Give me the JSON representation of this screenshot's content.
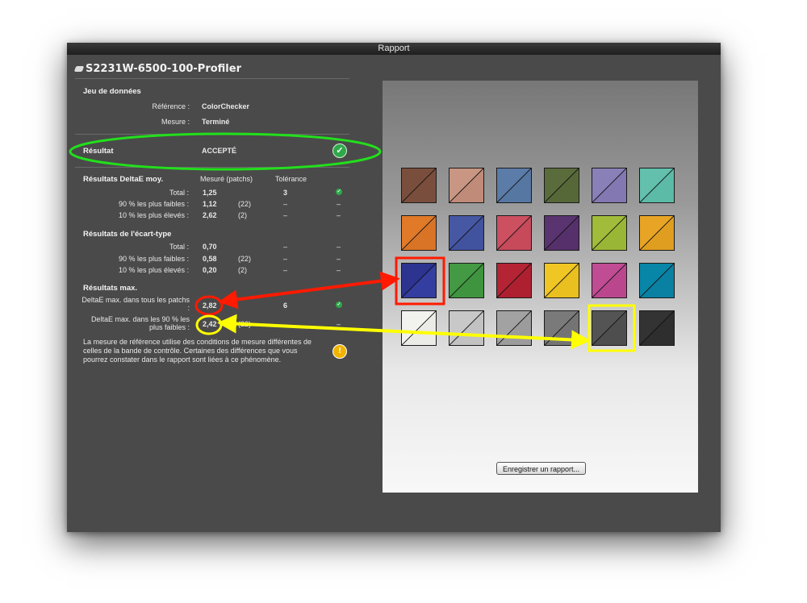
{
  "window": {
    "title": "Rapport"
  },
  "profile": {
    "title": "S2231W-6500-100-Profiler"
  },
  "dataset": {
    "header": "Jeu de données",
    "reference_label": "Référence :",
    "reference_value": "ColorChecker",
    "measure_label": "Mesure :",
    "measure_value": "Terminé"
  },
  "result": {
    "label": "Résultat",
    "value": "ACCEPTÉ"
  },
  "deltae_avg": {
    "header": "Résultats DeltaE moy.",
    "col_measured": "Mesuré (patchs)",
    "col_tolerance": "Tolérance",
    "rows": [
      {
        "label": "Total :",
        "value": "1,25",
        "patches": "",
        "tolerance": "3"
      },
      {
        "label": "90 % les plus faibles :",
        "value": "1,12",
        "patches": "(22)",
        "tolerance": "–"
      },
      {
        "label": "10 % les plus élevés :",
        "value": "2,62",
        "patches": "(2)",
        "tolerance": "–"
      }
    ],
    "row_status": [
      "–",
      "–"
    ]
  },
  "stddev": {
    "header": "Résultats de l'écart-type",
    "rows": [
      {
        "label": "Total :",
        "value": "0,70",
        "patches": "",
        "tolerance": "–",
        "status": "–"
      },
      {
        "label": "90 % les plus faibles :",
        "value": "0,58",
        "patches": "(22)",
        "tolerance": "–",
        "status": "–"
      },
      {
        "label": "10 % les plus élevés :",
        "value": "0,20",
        "patches": "(2)",
        "tolerance": "–",
        "status": "–"
      }
    ]
  },
  "max": {
    "header": "Résultats max.",
    "row1_label_line1": "DeltaE max. dans tous les patchs",
    "row1_label_line2": ":",
    "row1_value": "2,82",
    "row1_tolerance": "6",
    "row2_label_line1": "DeltaE max. dans les 90 % les",
    "row2_label_line2": "plus faibles :",
    "row2_value": "2,42",
    "row2_patches": "(22)",
    "row2_tolerance": "–",
    "row2_status": "–"
  },
  "note": {
    "line1": "La mesure de référence utilise des conditions de mesure différentes de",
    "line2": "celles de la bande de contrôle. Certaines des différences que vous",
    "line3": "pourrez constater dans le rapport sont liées à ce phénomène."
  },
  "icons": {
    "check": "check-icon",
    "warning": "warning-icon",
    "profile": "profile-icon"
  },
  "colors": {
    "highlight_green": "#22e01c",
    "highlight_red": "#ff1a00",
    "highlight_yellow": "#ffff00",
    "accept_green": "#2fa84a"
  },
  "patches": [
    [
      "#7a4e3c",
      "#7a4e3c"
    ],
    [
      "#c89682",
      "#c08b78"
    ],
    [
      "#5b7ca8",
      "#5677a2"
    ],
    [
      "#5a6b3c",
      "#576838"
    ],
    [
      "#8a80b8",
      "#8478b2"
    ],
    [
      "#62c0ac",
      "#5cbba6"
    ],
    [
      "#e07a28",
      "#d97426"
    ],
    [
      "#4658a4",
      "#41529e"
    ],
    [
      "#cc5060",
      "#c64a5a"
    ],
    [
      "#5a3470",
      "#55306a"
    ],
    [
      "#a0bc3a",
      "#9ab636"
    ],
    [
      "#e8a424",
      "#e09e20"
    ],
    [
      "#2c3490",
      "#343ea0"
    ],
    [
      "#449a44",
      "#3f943f"
    ],
    [
      "#b42434",
      "#ae2030"
    ],
    [
      "#f0c624",
      "#eabf20"
    ],
    [
      "#c04c94",
      "#ba478e"
    ],
    [
      "#0886a8",
      "#0a80a2"
    ],
    [
      "#f2f2ee",
      "#ebebe7"
    ],
    [
      "#c8c8c8",
      "#c2c2c2"
    ],
    [
      "#a2a2a2",
      "#9c9c9c"
    ],
    [
      "#7a7a7a",
      "#747474"
    ],
    [
      "#545454",
      "#4e4e4e"
    ],
    [
      "#333333",
      "#2e2e2e"
    ]
  ],
  "save_button": {
    "label": "Enregistrer un rapport..."
  }
}
